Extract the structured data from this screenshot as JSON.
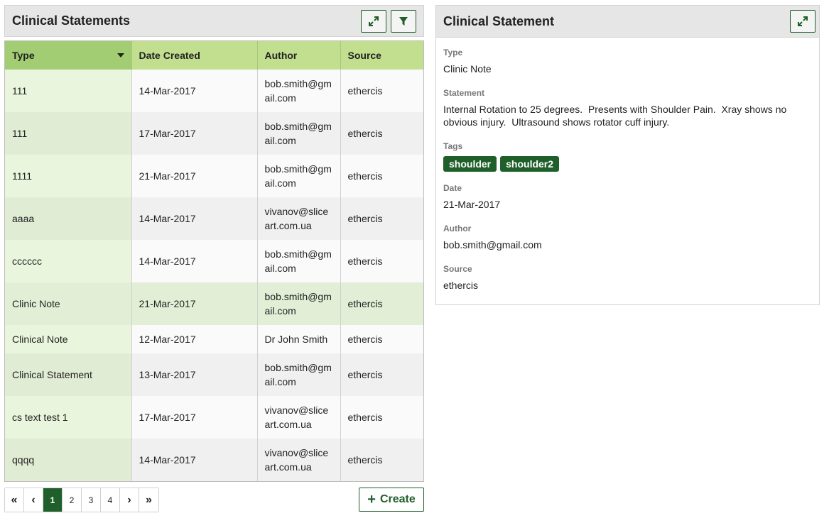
{
  "list_panel": {
    "title": "Clinical Statements",
    "expand_icon": "expand-icon",
    "filter_icon": "filter-icon"
  },
  "table": {
    "columns": [
      "Type",
      "Date Created",
      "Author",
      "Source"
    ],
    "rows": [
      {
        "type": "111",
        "date": "14-Mar-2017",
        "author": "bob.smith@gmail.com",
        "source": "ethercis"
      },
      {
        "type": "111",
        "date": "17-Mar-2017",
        "author": "bob.smith@gmail.com",
        "source": "ethercis"
      },
      {
        "type": "1111",
        "date": "21-Mar-2017",
        "author": "bob.smith@gmail.com",
        "source": "ethercis"
      },
      {
        "type": "aaaa",
        "date": "14-Mar-2017",
        "author": "vivanov@sliceart.com.ua",
        "source": "ethercis"
      },
      {
        "type": "cccccc",
        "date": "14-Mar-2017",
        "author": "bob.smith@gmail.com",
        "source": "ethercis"
      },
      {
        "type": "Clinic Note",
        "date": "21-Mar-2017",
        "author": "bob.smith@gmail.com",
        "source": "ethercis"
      },
      {
        "type": "Clinical Note",
        "date": "12-Mar-2017",
        "author": "Dr John Smith",
        "source": "ethercis"
      },
      {
        "type": "Clinical Statement",
        "date": "13-Mar-2017",
        "author": "bob.smith@gmail.com",
        "source": "ethercis"
      },
      {
        "type": "cs text test 1",
        "date": "17-Mar-2017",
        "author": "vivanov@sliceart.com.ua",
        "source": "ethercis"
      },
      {
        "type": "qqqq",
        "date": "14-Mar-2017",
        "author": "vivanov@sliceart.com.ua",
        "source": "ethercis"
      }
    ]
  },
  "pagination": {
    "first": "«",
    "prev": "‹",
    "pages": [
      "1",
      "2",
      "3",
      "4"
    ],
    "current": "1",
    "next": "›",
    "last": "»"
  },
  "create_button": {
    "label": "Create"
  },
  "detail_panel": {
    "title": "Clinical Statement",
    "type_label": "Type",
    "type_value": "Clinic Note",
    "statement_label": "Statement",
    "statement_value": "Internal Rotation to 25 degrees.  Presents with Shoulder Pain.  Xray shows no obvious injury.  Ultrasound shows rotator cuff injury.",
    "tags_label": "Tags",
    "tags": [
      "shoulder",
      "shoulder2"
    ],
    "date_label": "Date",
    "date_value": "21-Mar-2017",
    "author_label": "Author",
    "author_value": "bob.smith@gmail.com",
    "source_label": "Source",
    "source_value": "ethercis"
  },
  "colors": {
    "accent": "#1f5f2a",
    "header_green": "#c1df8f",
    "sorted_header_green": "#a3cd72"
  }
}
